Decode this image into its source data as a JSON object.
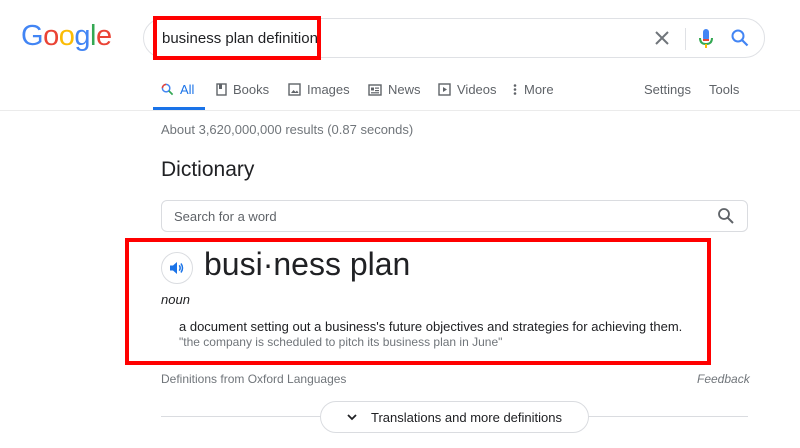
{
  "logo": {
    "letters": [
      "G",
      "o",
      "o",
      "g",
      "l",
      "e"
    ],
    "colors": [
      "#4285f4",
      "#ea4335",
      "#fbbc05",
      "#4285f4",
      "#34a853",
      "#ea4335"
    ]
  },
  "search": {
    "query": "business plan definition"
  },
  "tabs": [
    {
      "label": "All",
      "icon": "search-icon",
      "active": true
    },
    {
      "label": "Books",
      "icon": "book-icon"
    },
    {
      "label": "Images",
      "icon": "image-icon"
    },
    {
      "label": "News",
      "icon": "news-icon"
    },
    {
      "label": "Videos",
      "icon": "video-icon"
    },
    {
      "label": "More",
      "icon": "more-vert-icon"
    }
  ],
  "tools": {
    "settings": "Settings",
    "tools": "Tools"
  },
  "result_stats": "About 3,620,000,000 results (0.87 seconds)",
  "dictionary": {
    "title": "Dictionary",
    "search_placeholder": "Search for a word",
    "headword": "busi·ness plan",
    "part_of_speech": "noun",
    "definition": "a document setting out a business's future objectives and strategies for achieving them.",
    "example": "\"the company is scheduled to pitch its business plan in June\"",
    "source": "Definitions from Oxford Languages",
    "feedback": "Feedback",
    "more_button": "Translations and more definitions"
  },
  "colors": {
    "accent": "#1a73e8",
    "annotation": "#ff0000"
  }
}
